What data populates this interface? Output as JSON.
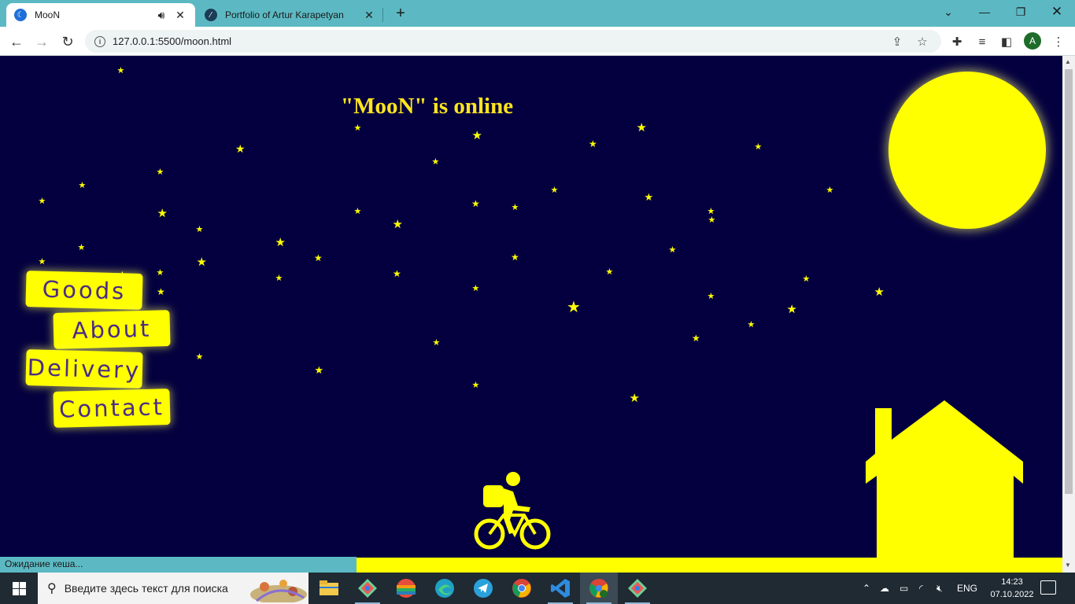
{
  "browser": {
    "tabs": [
      {
        "title": "MooN",
        "active": true,
        "audio": true
      },
      {
        "title": "Portfolio of Artur Karapetyan",
        "active": false
      }
    ],
    "url": "127.0.0.1:5500/moon.html",
    "profile_initial": "A"
  },
  "page": {
    "title": "\"MooN\" is online",
    "menu": [
      {
        "label": "Goods"
      },
      {
        "label": "About"
      },
      {
        "label": "Delivery"
      },
      {
        "label": "Contact"
      }
    ],
    "colors": {
      "sky": "#04003f",
      "accent": "#ffff00",
      "menu_text": "#4a2b86"
    }
  },
  "status_text": "Ожидание кеша...",
  "taskbar": {
    "search_placeholder": "Введите здесь текст для поиска",
    "apps": [
      "file-explorer",
      "git-kraken",
      "lgbt-app",
      "edge",
      "telegram",
      "chrome",
      "vscode",
      "chrome-profile",
      "git-kraken-2"
    ],
    "tray": {
      "language": "ENG",
      "time": "14:23",
      "date": "07.10.2022"
    }
  }
}
